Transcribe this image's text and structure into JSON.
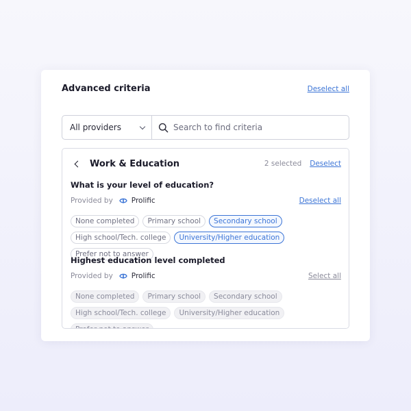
{
  "card": {
    "title": "Advanced criteria",
    "deselect_all_label": "Deselect all"
  },
  "filter": {
    "provider_selected": "All providers",
    "search_placeholder": "Search to find criteria",
    "search_value": ""
  },
  "panel": {
    "title": "Work & Education",
    "selected_count": "2 selected",
    "deselect_label": "Deselect"
  },
  "questions": [
    {
      "title": "What is your level of education?",
      "provided_by_label": "Provided by",
      "provider": "Prolific",
      "action_label": "Deselect all",
      "options": [
        {
          "label": "None completed",
          "state": "default"
        },
        {
          "label": "Primary school",
          "state": "default"
        },
        {
          "label": "Secondary school",
          "state": "selected"
        },
        {
          "label": "High school/Tech. college",
          "state": "default"
        },
        {
          "label": "University/Higher education",
          "state": "selected"
        },
        {
          "label": "Prefer not to answer",
          "state": "default"
        }
      ]
    },
    {
      "title": "Highest education level completed",
      "provided_by_label": "Provided by",
      "provider": "Prolific",
      "action_label": "Select all",
      "options": [
        {
          "label": "None completed",
          "state": "muted"
        },
        {
          "label": "Primary school",
          "state": "muted"
        },
        {
          "label": "Secondary school",
          "state": "muted"
        },
        {
          "label": "High school/Tech. college",
          "state": "muted"
        },
        {
          "label": "University/Higher education",
          "state": "muted"
        },
        {
          "label": "Prefer not to answer",
          "state": "muted"
        }
      ]
    }
  ],
  "icons": {
    "provider_chevron": "chevron-down-icon",
    "search": "search-icon",
    "back": "chevron-left-icon",
    "provider_logo": "prolific-logo-icon"
  },
  "colors": {
    "accent": "#3b74d6",
    "muted_text": "#8a8a99",
    "border": "#cfd1db"
  }
}
